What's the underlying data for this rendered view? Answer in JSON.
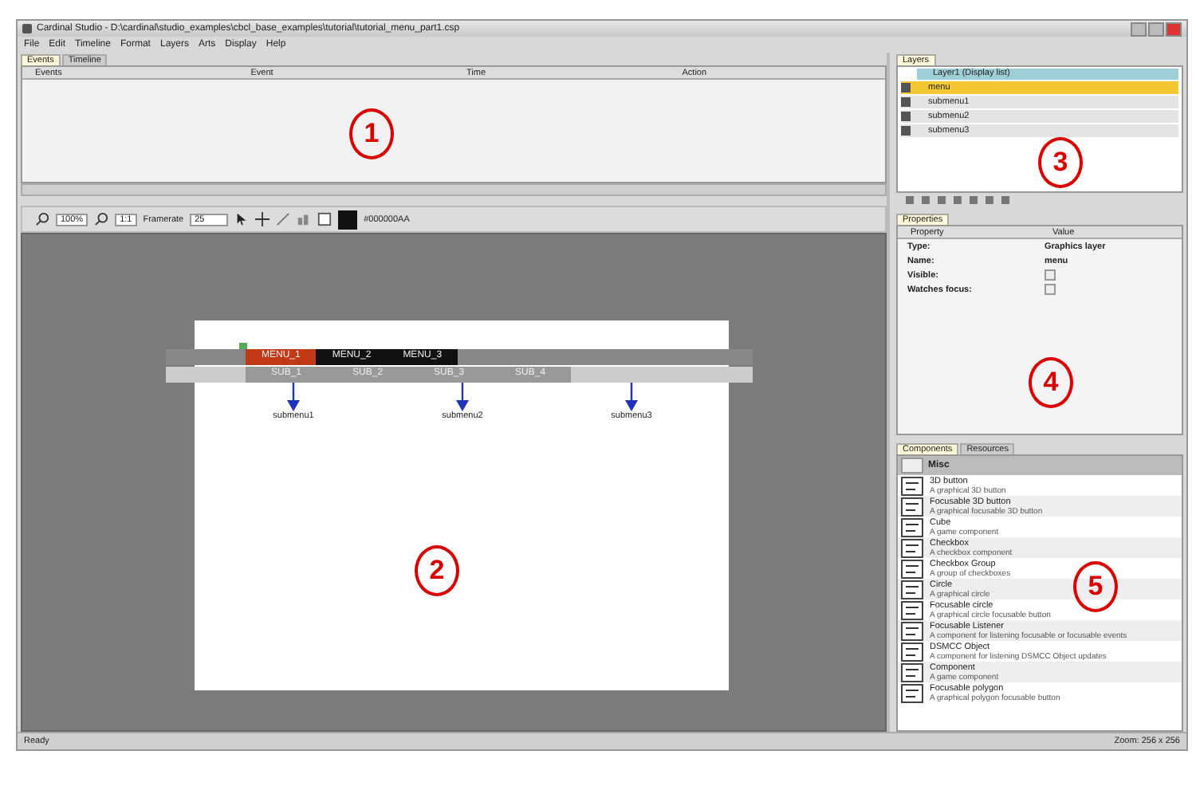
{
  "window": {
    "title": "Cardinal Studio - D:\\cardinal\\studio_examples\\cbcl_base_examples\\tutorial\\tutorial_menu_part1.csp"
  },
  "menu": [
    "File",
    "Edit",
    "Timeline",
    "Format",
    "Layers",
    "Arts",
    "Display",
    "Help"
  ],
  "events_panel": {
    "tabs": [
      {
        "label": "Events",
        "selected": true
      },
      {
        "label": "Timeline",
        "selected": false
      }
    ],
    "columns": [
      "Events",
      "Event",
      "Time",
      "Action"
    ],
    "marker": "1"
  },
  "toolbar": {
    "zoom": "100%",
    "scale": "1:1",
    "framerate_label": "Framerate",
    "framerate": "25",
    "color_code": "#000000AA"
  },
  "canvas": {
    "marker": "2",
    "menu_items": [
      {
        "label": "MENU_1",
        "selected": true
      },
      {
        "label": "MENU_2",
        "selected": false
      },
      {
        "label": "MENU_3",
        "selected": false
      }
    ],
    "sub_items": [
      "SUB_1",
      "SUB_2",
      "SUB_3",
      "SUB_4"
    ],
    "targets": [
      "submenu1",
      "submenu2",
      "submenu3"
    ]
  },
  "layers_panel": {
    "tab": "Layers",
    "root": "Layer1 (Display list)",
    "marker": "3",
    "items": [
      {
        "name": "menu",
        "selected": true
      },
      {
        "name": "submenu1",
        "selected": false
      },
      {
        "name": "submenu2",
        "selected": false
      },
      {
        "name": "submenu3",
        "selected": false
      }
    ]
  },
  "properties_panel": {
    "tab": "Properties",
    "columns": [
      "Property",
      "Value"
    ],
    "marker": "4",
    "rows": [
      {
        "kind": "text",
        "name": "Type:",
        "value": "Graphics layer"
      },
      {
        "kind": "text",
        "name": "Name:",
        "value": "menu"
      },
      {
        "kind": "checkbox",
        "name": "Visible:",
        "checked": false
      },
      {
        "kind": "checkbox",
        "name": "Watches focus:",
        "checked": false
      }
    ]
  },
  "components_panel": {
    "tabs": [
      {
        "label": "Components",
        "selected": true
      },
      {
        "label": "Resources",
        "selected": false
      }
    ],
    "category": "Misc",
    "marker": "5",
    "items": [
      {
        "name": "3D button",
        "description": "A graphical 3D button"
      },
      {
        "name": "Focusable 3D button",
        "description": "A graphical focusable 3D button"
      },
      {
        "name": "Cube",
        "description": "A game component"
      },
      {
        "name": "Checkbox",
        "description": "A checkbox component"
      },
      {
        "name": "Checkbox Group",
        "description": "A group of checkboxes"
      },
      {
        "name": "Circle",
        "description": "A graphical circle"
      },
      {
        "name": "Focusable circle",
        "description": "A graphical circle focusable button"
      },
      {
        "name": "Focusable Listener",
        "description": "A component for listening focusable or focusable events"
      },
      {
        "name": "DSMCC Object",
        "description": "A component for listening DSMCC Object updates"
      },
      {
        "name": "Component",
        "description": "A game component"
      },
      {
        "name": "Focusable polygon",
        "description": "A graphical polygon focusable button"
      }
    ]
  },
  "status_bar": {
    "text": "Ready",
    "info": "Zoom: 256 x 256"
  }
}
